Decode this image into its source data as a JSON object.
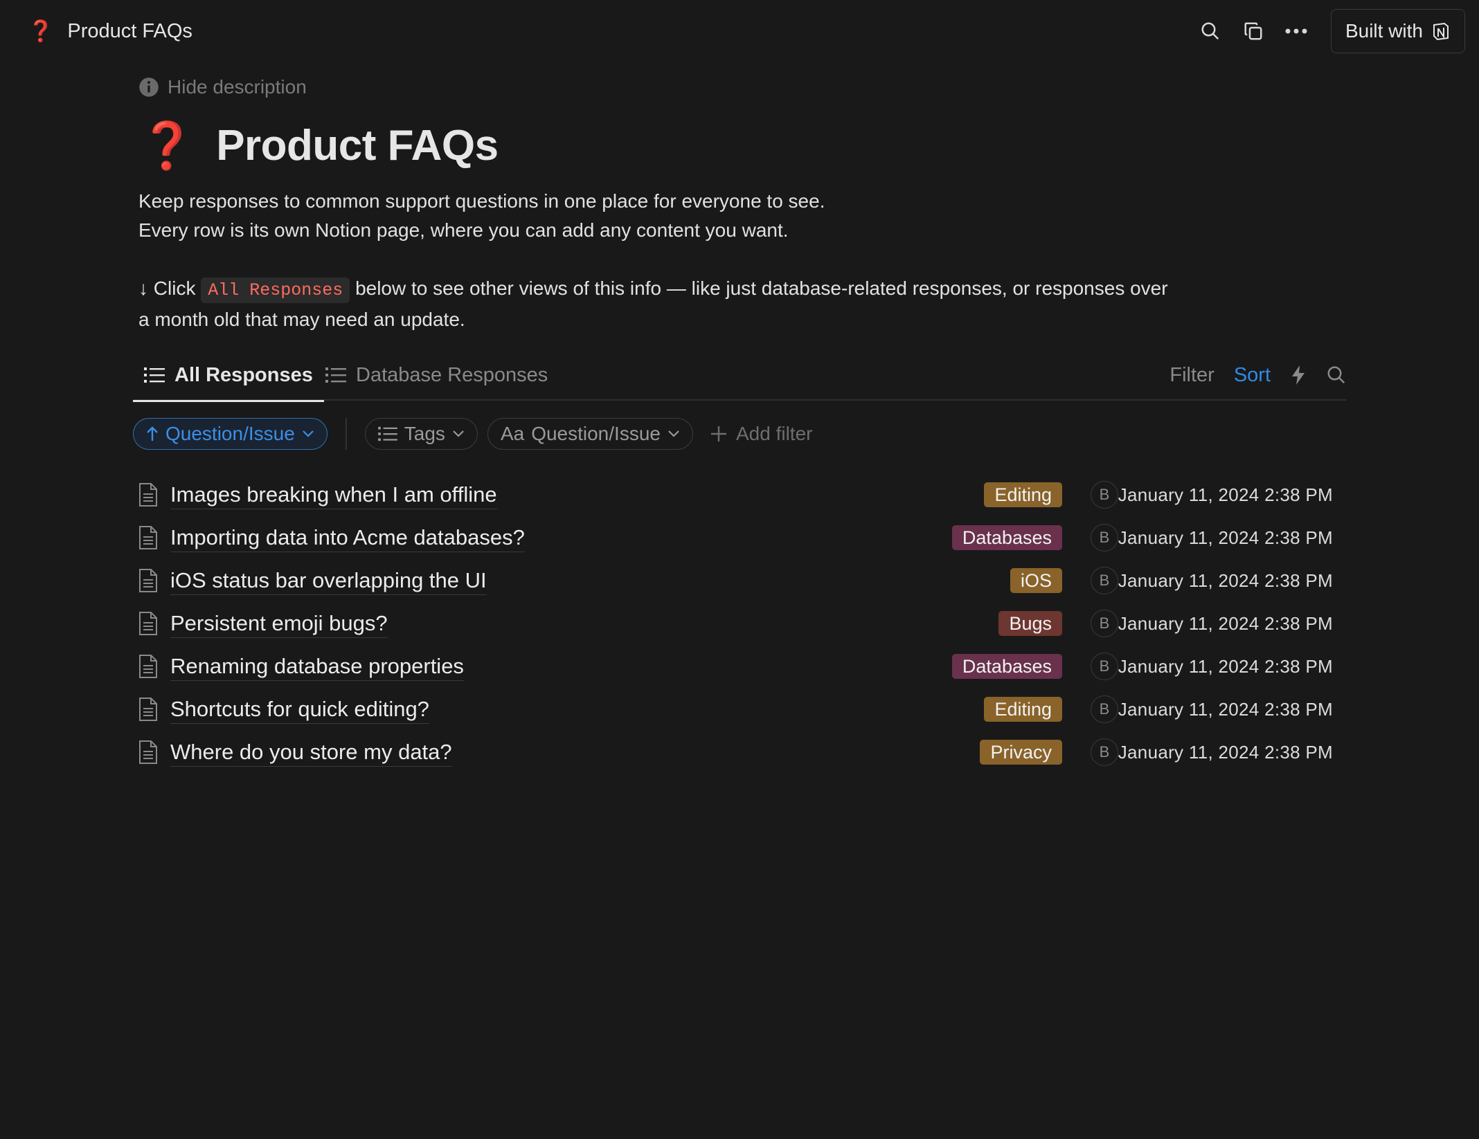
{
  "topbar": {
    "emoji": "❓",
    "page_title": "Product FAQs",
    "built_with_label": "Built with"
  },
  "header": {
    "hide_description": "Hide description",
    "emoji": "❓",
    "title": "Product FAQs",
    "desc_line1": "Keep responses to common support questions in one place for everyone to see.",
    "desc_line2": "Every row is its own Notion page, where you can add any content you want.",
    "desc_line3_prefix": "↓ Click",
    "desc_line3_code": "All Responses",
    "desc_line3_suffix": "below to see other views of this info — like just database-related responses, or responses over",
    "desc_line4": "a month old that may need an update."
  },
  "tabs": [
    {
      "label": "All Responses",
      "active": true
    },
    {
      "label": "Database Responses",
      "active": false
    }
  ],
  "tools": {
    "filter": "Filter",
    "sort": "Sort"
  },
  "filters": {
    "sort_chip": "Question/Issue",
    "tags_chip": "Tags",
    "title_chip_prefix": "Aa",
    "title_chip": "Question/Issue",
    "add_filter": "Add filter"
  },
  "rows": [
    {
      "title": "Images breaking when I am offline",
      "tag": "Editing",
      "tag_color": "#89632a",
      "avatar": "B",
      "date": "January 11, 2024 2:38 PM"
    },
    {
      "title": "Importing data into Acme databases?",
      "tag": "Databases",
      "tag_color": "#69314c",
      "avatar": "B",
      "date": "January 11, 2024 2:38 PM"
    },
    {
      "title": "iOS status bar overlapping the UI",
      "tag": "iOS",
      "tag_color": "#89632a",
      "avatar": "B",
      "date": "January 11, 2024 2:38 PM"
    },
    {
      "title": "Persistent emoji bugs?",
      "tag": "Bugs",
      "tag_color": "#6e3630",
      "avatar": "B",
      "date": "January 11, 2024 2:38 PM"
    },
    {
      "title": "Renaming database properties",
      "tag": "Databases",
      "tag_color": "#69314c",
      "avatar": "B",
      "date": "January 11, 2024 2:38 PM"
    },
    {
      "title": "Shortcuts for quick editing?",
      "tag": "Editing",
      "tag_color": "#89632a",
      "avatar": "B",
      "date": "January 11, 2024 2:38 PM"
    },
    {
      "title": "Where do you store my data?",
      "tag": "Privacy",
      "tag_color": "#89632a",
      "avatar": "B",
      "date": "January 11, 2024 2:38 PM"
    }
  ]
}
